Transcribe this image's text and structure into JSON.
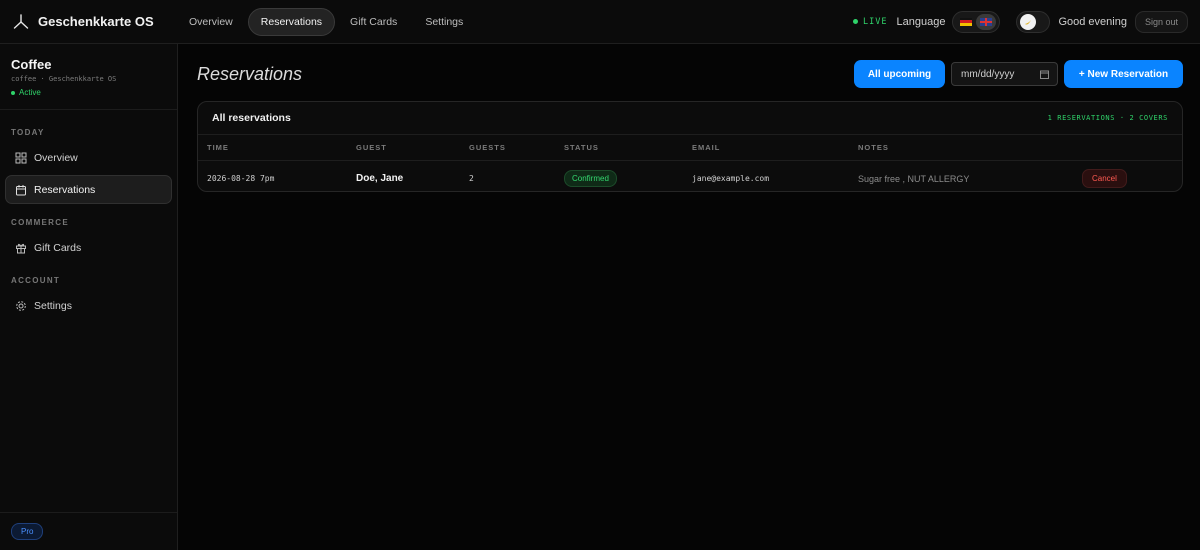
{
  "brand": {
    "name": "Geschenkkarte OS",
    "icon": "tripod-icon"
  },
  "topnav": {
    "items": [
      {
        "label": "Overview",
        "active": false
      },
      {
        "label": "Reservations",
        "active": true
      },
      {
        "label": "Gift Cards",
        "active": false
      },
      {
        "label": "Settings",
        "active": false
      }
    ]
  },
  "header": {
    "live_label": "LIVE",
    "language_label": "Language",
    "languages": [
      "de",
      "en-GB"
    ],
    "selected_language": "en-GB",
    "theme_icon": "banana-icon",
    "greeting": "Good evening",
    "signout_label": "Sign out"
  },
  "sidebar": {
    "workspace": {
      "name": "Coffee",
      "subtitle": "coffee · Geschenkkarte OS",
      "status": "Active"
    },
    "sections": [
      {
        "title": "TODAY",
        "items": [
          {
            "label": "Overview",
            "icon": "grid-icon",
            "active": false
          },
          {
            "label": "Reservations",
            "icon": "calendar-icon",
            "active": true
          }
        ]
      },
      {
        "title": "COMMERCE",
        "items": [
          {
            "label": "Gift Cards",
            "icon": "gift-icon",
            "active": false
          }
        ]
      },
      {
        "title": "ACCOUNT",
        "items": [
          {
            "label": "Settings",
            "icon": "gear-icon",
            "active": false
          }
        ]
      }
    ],
    "plan_badge": "Pro"
  },
  "main": {
    "title": "Reservations",
    "filter_button": "All upcoming",
    "date_placeholder": "mm/dd/yyyy",
    "new_button": "+ New Reservation",
    "table": {
      "title": "All reservations",
      "summary": "1 RESERVATIONS · 2 COVERS",
      "columns": [
        "TIME",
        "GUEST",
        "GUESTS",
        "STATUS",
        "EMAIL",
        "NOTES"
      ],
      "rows": [
        {
          "time": "2026-08-28 7pm",
          "guest": "Doe, Jane",
          "guests": "2",
          "status": "Confirmed",
          "email": "jane@example.com",
          "notes": "Sugar free , NUT ALLERGY",
          "action": "Cancel"
        }
      ]
    }
  },
  "colors": {
    "accent": "#0a84ff",
    "live": "#2fd36a",
    "danger": "#ff5a52",
    "background": "#050505"
  }
}
